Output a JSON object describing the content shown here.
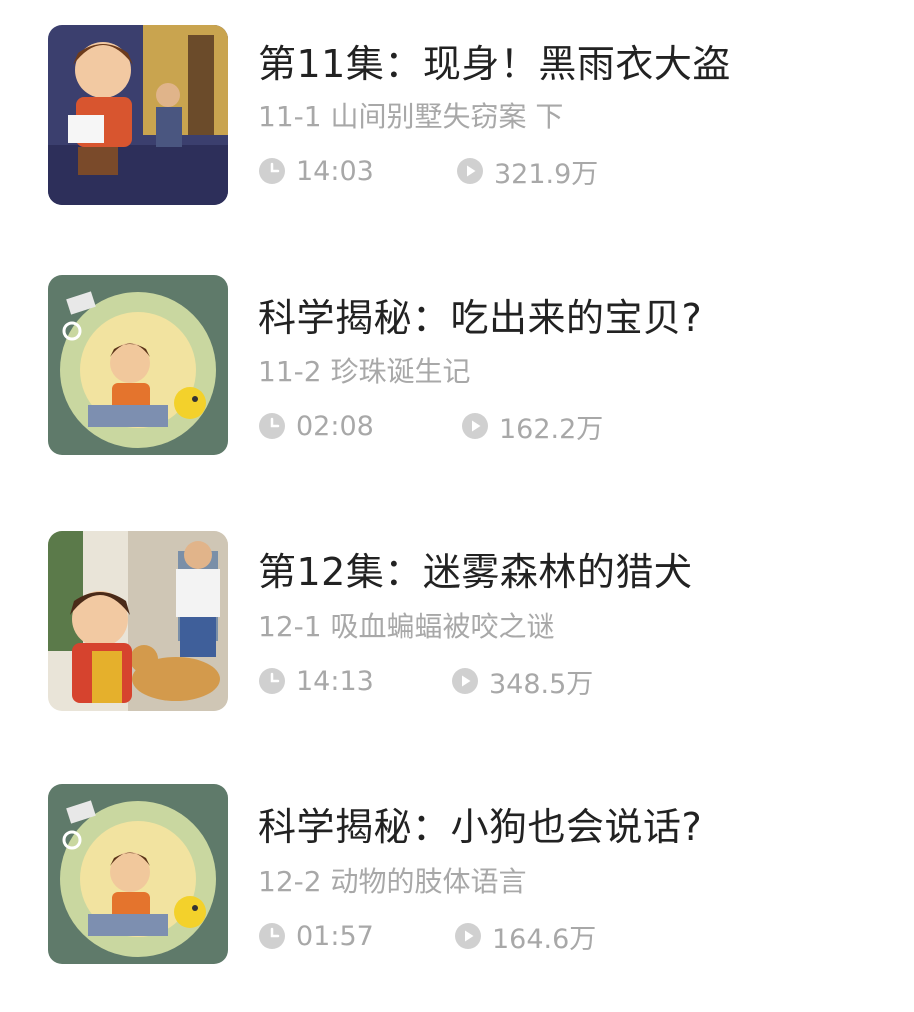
{
  "episodes": [
    {
      "title": "第11集：现身！黑雨衣大盗",
      "subtitle": "11-1 山间别墅失窃案 下",
      "duration": "14:03",
      "plays": "321.9万",
      "thumb": "detective-cover-icon"
    },
    {
      "title": "科学揭秘：吃出来的宝贝?",
      "subtitle": "11-2 珍珠诞生记",
      "duration": "02:08",
      "plays": "162.2万",
      "thumb": "science-cover-icon"
    },
    {
      "title": "第12集：迷雾森林的猎犬",
      "subtitle": "12-1 吸血蝙蝠被咬之谜",
      "duration": "14:13",
      "plays": "348.5万",
      "thumb": "dog-cover-icon"
    },
    {
      "title": "科学揭秘：小狗也会说话?",
      "subtitle": "12-2 动物的肢体语言",
      "duration": "01:57",
      "plays": "164.6万",
      "thumb": "science-cover-icon"
    }
  ],
  "icons": {
    "duration": "clock-icon",
    "plays": "play-count-icon"
  },
  "colors": {
    "title": "#222222",
    "meta": "#a8a8a8",
    "icon": "#d0d0d0",
    "background": "#ffffff"
  }
}
